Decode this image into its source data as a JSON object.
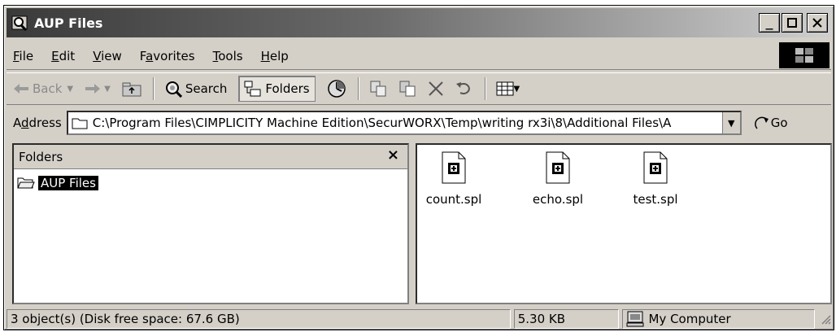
{
  "window": {
    "title": "AUP Files"
  },
  "menu": [
    {
      "pre": "",
      "u": "F",
      "post": "ile"
    },
    {
      "pre": "",
      "u": "E",
      "post": "dit"
    },
    {
      "pre": "",
      "u": "V",
      "post": "iew"
    },
    {
      "pre": "F",
      "u": "a",
      "post": "vorites"
    },
    {
      "pre": "",
      "u": "T",
      "post": "ools"
    },
    {
      "pre": "",
      "u": "H",
      "post": "elp"
    }
  ],
  "toolbar": {
    "back": "Back",
    "search": "Search",
    "folders": "Folders"
  },
  "address": {
    "label_pre": "A",
    "label_u": "d",
    "label_post": "dress",
    "path": "C:\\Program Files\\CIMPLICITY Machine Edition\\SecurWORX\\Temp\\writing rx3i\\8\\Additional Files\\A",
    "go": "Go"
  },
  "folders": {
    "header": "Folders",
    "close": "×",
    "tree_item": "AUP Files"
  },
  "files": [
    {
      "name": "count.spl",
      "icon": "spl-file-icon"
    },
    {
      "name": "echo.spl",
      "icon": "spl-file-icon"
    },
    {
      "name": "test.spl",
      "icon": "spl-file-icon"
    }
  ],
  "status": {
    "objects": "3 object(s) (Disk free space: 67.6 GB)",
    "size": "5.30 KB",
    "zone": "My Computer"
  }
}
